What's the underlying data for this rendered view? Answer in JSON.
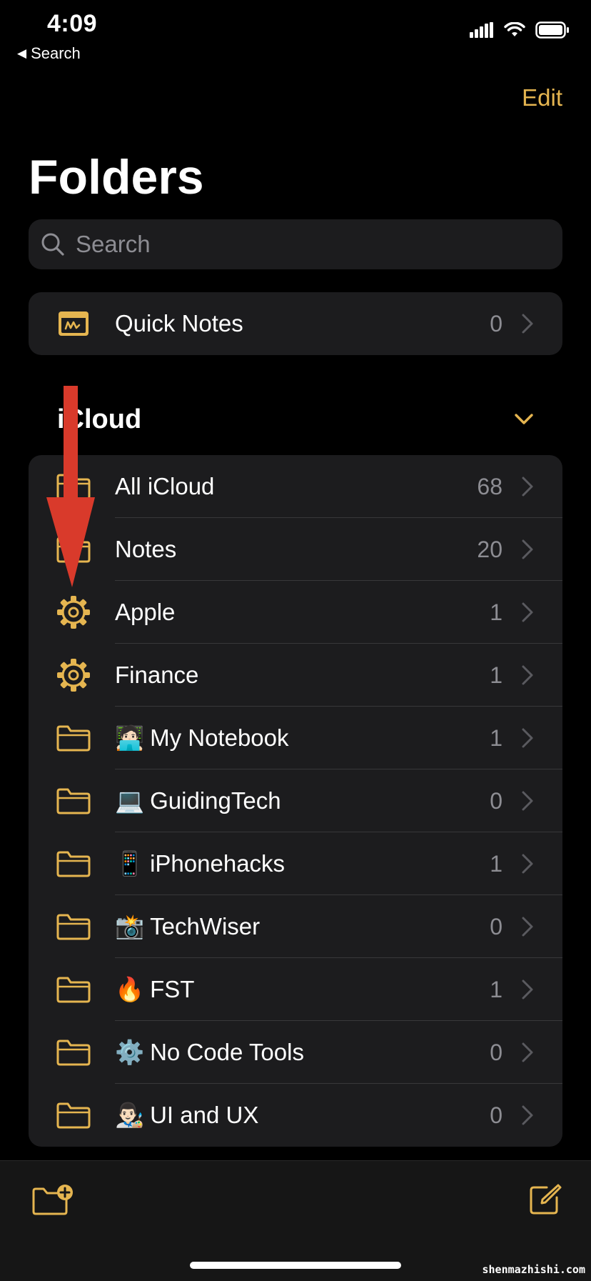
{
  "status_bar": {
    "time": "4:09",
    "back_label": "Search"
  },
  "header": {
    "edit_label": "Edit",
    "title": "Folders"
  },
  "search": {
    "placeholder": "Search"
  },
  "quick_notes": {
    "label": "Quick Notes",
    "count": "0"
  },
  "section": {
    "title": "iCloud"
  },
  "folders": [
    {
      "label": "All iCloud",
      "count": "68",
      "icon": "folder-icon",
      "emoji": ""
    },
    {
      "label": "Notes",
      "count": "20",
      "icon": "folder-icon",
      "emoji": ""
    },
    {
      "label": "Apple",
      "count": "1",
      "icon": "gear-icon",
      "emoji": ""
    },
    {
      "label": "Finance",
      "count": "1",
      "icon": "gear-icon",
      "emoji": ""
    },
    {
      "label": "My Notebook",
      "count": "1",
      "icon": "folder-icon",
      "emoji": "🧑🏻‍💻"
    },
    {
      "label": "GuidingTech",
      "count": "0",
      "icon": "folder-icon",
      "emoji": "💻"
    },
    {
      "label": "iPhonehacks",
      "count": "1",
      "icon": "folder-icon",
      "emoji": "📱"
    },
    {
      "label": "TechWiser",
      "count": "0",
      "icon": "folder-icon",
      "emoji": "📸"
    },
    {
      "label": "FST",
      "count": "1",
      "icon": "folder-icon",
      "emoji": "🔥"
    },
    {
      "label": "No Code Tools",
      "count": "0",
      "icon": "folder-icon",
      "emoji": "⚙️"
    },
    {
      "label": "UI and UX",
      "count": "0",
      "icon": "folder-icon",
      "emoji": "👨🏻‍🎨"
    }
  ],
  "toolbar": {
    "new_folder_icon": "new-folder-icon",
    "compose_icon": "compose-icon"
  },
  "watermark": "shenmazhishi.com",
  "colors": {
    "accent": "#e5b550",
    "arrow": "#d93a2b",
    "card": "#1c1c1e"
  }
}
